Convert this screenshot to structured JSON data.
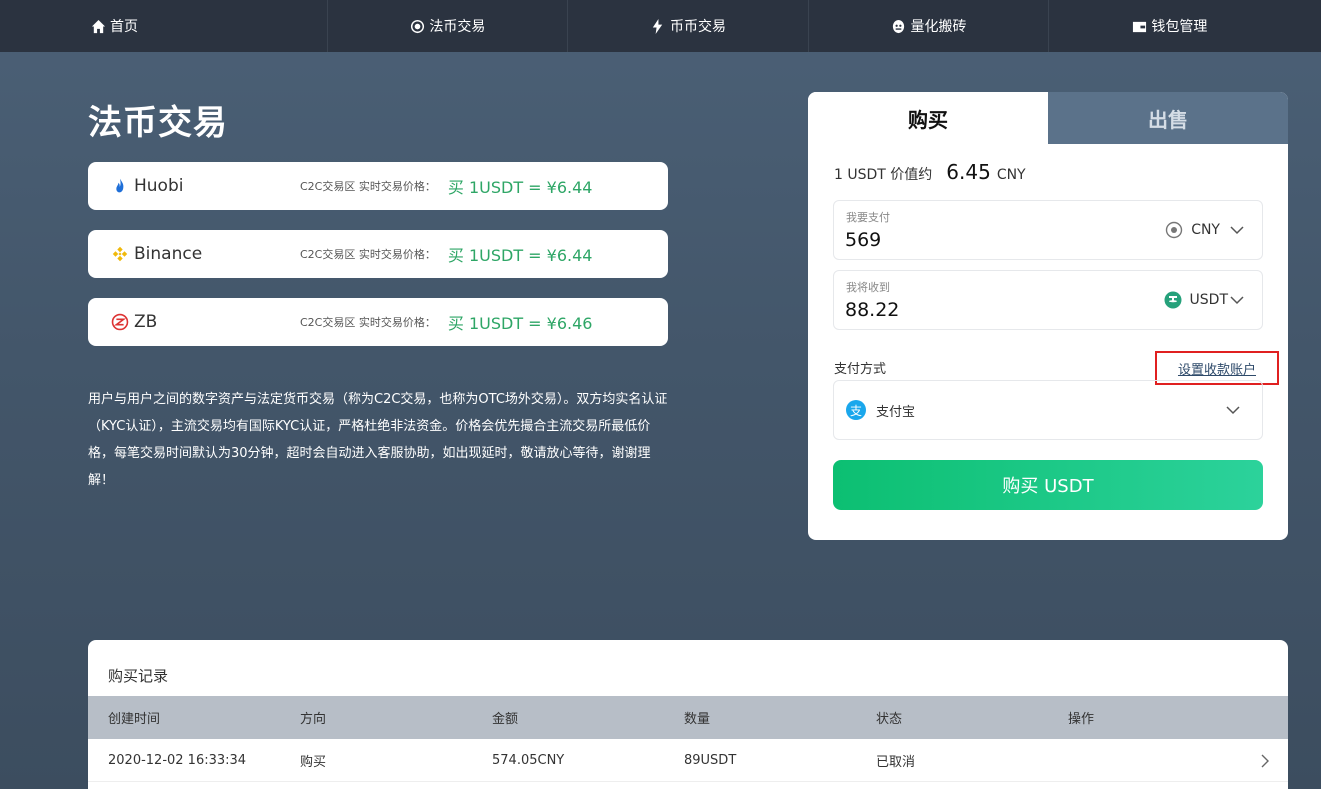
{
  "nav": [
    {
      "label": "首页",
      "icon": "home-icon"
    },
    {
      "label": "法币交易",
      "icon": "target-icon"
    },
    {
      "label": "币币交易",
      "icon": "lightning-icon"
    },
    {
      "label": "量化搬砖",
      "icon": "robot-icon"
    },
    {
      "label": "钱包管理",
      "icon": "wallet-icon"
    }
  ],
  "page_title": "法币交易",
  "exchanges": [
    {
      "name": "Huobi",
      "label": "C2C交易区 实时交易价格：",
      "price": "买 1USDT = ¥6.44",
      "icon": "huobi-flame-icon"
    },
    {
      "name": "Binance",
      "label": "C2C交易区 实时交易价格：",
      "price": "买 1USDT = ¥6.44",
      "icon": "binance-icon"
    },
    {
      "name": "ZB",
      "label": "C2C交易区 实时交易价格：",
      "price": "买 1USDT = ¥6.46",
      "icon": "zb-icon"
    }
  ],
  "description": "用户与用户之间的数字资产与法定货币交易（称为C2C交易，也称为OTC场外交易）。双方均实名认证（KYC认证），主流交易均有国际KYC认证，严格杜绝非法资金。价格会优先撮合主流交易所最低价格，每笔交易时间默认为30分钟，超时会自动进入客服协助，如出现延时，敬请放心等待，谢谢理解！",
  "trade": {
    "tab_buy": "购买",
    "tab_sell": "出售",
    "rate_prefix": "1 USDT 价值约",
    "rate_value": "6.45",
    "rate_unit": "CNY",
    "pay_label": "我要支付",
    "pay_value": "569",
    "pay_currency": "CNY",
    "receive_label": "我将收到",
    "receive_value": "88.22",
    "receive_currency": "USDT",
    "method_label": "支付方式",
    "set_account_link": "设置收款账户",
    "method_selected": "支付宝",
    "buy_button": "购买 USDT"
  },
  "records": {
    "title": "购买记录",
    "columns": [
      "创建时间",
      "方向",
      "金额",
      "数量",
      "状态",
      "操作"
    ],
    "rows": [
      [
        "2020-12-02 16:33:34",
        "购买",
        "574.05CNY",
        "89USDT",
        "已取消",
        ""
      ]
    ]
  },
  "colors": {
    "nav_bg": "#2b3340",
    "accent_green": "#2ea666",
    "button_green": "#0cbf72",
    "highlight_red": "#e02020"
  }
}
